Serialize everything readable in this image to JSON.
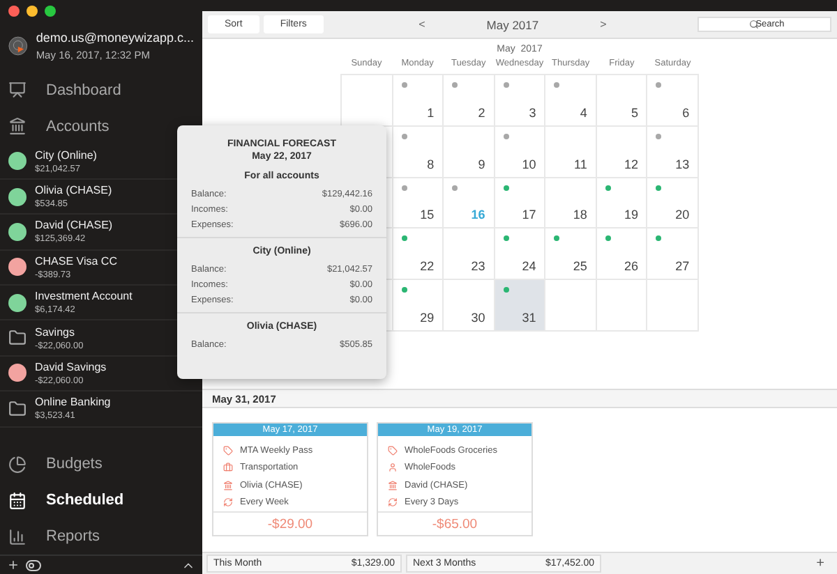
{
  "profile": {
    "email": "demo.us@moneywizapp.c...",
    "datetime": "May 16, 2017, 12:32 PM"
  },
  "nav_top": [
    {
      "kind": "dashboard",
      "label": "Dashboard",
      "selected": false
    },
    {
      "kind": "accounts",
      "label": "Accounts",
      "selected": false
    }
  ],
  "accounts": [
    {
      "kind": "account",
      "name": "City (Online)",
      "balance": "$21,042.57",
      "color": "#7fd49a"
    },
    {
      "kind": "account",
      "name": "Olivia (CHASE)",
      "balance": "$534.85",
      "color": "#7fd49a"
    },
    {
      "kind": "account",
      "name": "David (CHASE)",
      "balance": "$125,369.42",
      "color": "#7fd49a"
    },
    {
      "kind": "account",
      "name": "CHASE Visa CC",
      "balance": "-$389.73",
      "color": "#f2a3a0"
    },
    {
      "kind": "account",
      "name": "Investment Account",
      "balance": "$6,174.42",
      "color": "#7fd49a"
    },
    {
      "kind": "group",
      "name": "Savings",
      "balance": "-$22,060.00",
      "children": [
        {
          "kind": "account",
          "name": "David Savings",
          "balance": "-$22,060.00",
          "color": "#f2a3a0"
        }
      ]
    },
    {
      "kind": "group",
      "name": "Online Banking",
      "balance": "$3,523.41"
    }
  ],
  "nav_bottom": [
    {
      "kind": "budgets",
      "label": "Budgets",
      "selected": false
    },
    {
      "kind": "scheduled",
      "label": "Scheduled",
      "selected": true
    },
    {
      "kind": "reports",
      "label": "Reports",
      "selected": false
    }
  ],
  "toolbar": {
    "buttons": [
      "Sort",
      "Filters"
    ],
    "prev": "<",
    "month": "May 2017",
    "next": ">",
    "search": {
      "placeholder": "Search"
    }
  },
  "calendar": {
    "title": "May  2017",
    "weekdays": [
      "Sunday",
      "Monday",
      "Tuesday",
      "Wednesday",
      "Thursday",
      "Friday",
      "Saturday"
    ],
    "cells": [
      {},
      {
        "day": "1",
        "color": "#a8a8a8",
        "selected": false
      },
      {
        "day": "2",
        "color": "#a8a8a8",
        "selected": false
      },
      {
        "day": "3",
        "color": "#a8a8a8",
        "selected": false
      },
      {
        "day": "4",
        "color": "#a8a8a8",
        "selected": false
      },
      {
        "day": "5",
        "selected": false
      },
      {
        "day": "6",
        "color": "#a8a8a8",
        "selected": false
      },
      {},
      {
        "day": "8",
        "color": "#a8a8a8",
        "selected": false
      },
      {
        "day": "9",
        "selected": false
      },
      {
        "day": "10",
        "color": "#a8a8a8",
        "selected": false
      },
      {
        "day": "11",
        "selected": false
      },
      {
        "day": "12",
        "selected": false
      },
      {
        "day": "13",
        "color": "#a8a8a8",
        "selected": false
      },
      {},
      {
        "day": "15",
        "color": "#a8a8a8",
        "selected": false
      },
      {
        "day": "16",
        "color": "#a8a8a8",
        "today": true,
        "selected": false
      },
      {
        "day": "17",
        "color": "#2bb673",
        "selected": false
      },
      {
        "day": "18",
        "selected": false
      },
      {
        "day": "19",
        "color": "#2bb673",
        "selected": false
      },
      {
        "day": "20",
        "color": "#2bb673",
        "selected": false
      },
      {},
      {
        "day": "22",
        "color": "#2bb673",
        "selected": false
      },
      {
        "day": "23",
        "selected": false
      },
      {
        "day": "24",
        "color": "#2bb673",
        "selected": false
      },
      {
        "day": "25",
        "color": "#2bb673",
        "selected": false
      },
      {
        "day": "26",
        "color": "#2bb673",
        "selected": false
      },
      {
        "day": "27",
        "color": "#2bb673",
        "selected": false
      },
      {},
      {
        "day": "29",
        "color": "#2bb673",
        "selected": false
      },
      {
        "day": "30",
        "selected": false
      },
      {
        "day": "31",
        "color": "#2bb673",
        "selected": true
      },
      {},
      {},
      {}
    ]
  },
  "forecast": {
    "title": "FINANCIAL FORECAST",
    "date": "May 22, 2017",
    "sections": [
      {
        "title": "For all accounts",
        "rows": [
          {
            "label": "Balance:",
            "value": "$129,442.16"
          },
          {
            "label": "Incomes:",
            "value": "$0.00"
          },
          {
            "label": "Expenses:",
            "value": "$696.00"
          }
        ]
      },
      {
        "title": "City (Online)",
        "rows": [
          {
            "label": "Balance:",
            "value": "$21,042.57"
          },
          {
            "label": "Incomes:",
            "value": "$0.00"
          },
          {
            "label": "Expenses:",
            "value": "$0.00"
          }
        ]
      },
      {
        "title": "Olivia (CHASE)",
        "rows": [
          {
            "label": "Balance:",
            "value": "$505.85"
          }
        ]
      }
    ]
  },
  "day_header": "May 31, 2017",
  "scheduled": [
    {
      "date": "May 17, 2017",
      "rows": [
        {
          "kind": "description",
          "text": "MTA Weekly Pass"
        },
        {
          "kind": "category",
          "text": "Transportation"
        },
        {
          "kind": "account",
          "text": "Olivia (CHASE)"
        },
        {
          "kind": "repeat",
          "text": "Every Week"
        }
      ],
      "amount": "-$29.00"
    },
    {
      "date": "May 19, 2017",
      "rows": [
        {
          "kind": "description",
          "text": "WholeFoods Groceries"
        },
        {
          "kind": "payee",
          "text": "WholeFoods"
        },
        {
          "kind": "account",
          "text": "David (CHASE)"
        },
        {
          "kind": "repeat",
          "text": "Every 3 Days"
        }
      ],
      "amount": "-$65.00"
    }
  ],
  "footer": {
    "totals": [
      {
        "label": "This Month",
        "value": "$1,329.00"
      },
      {
        "label": "Next 3 Months",
        "value": "$17,452.00"
      }
    ],
    "add": "+"
  }
}
